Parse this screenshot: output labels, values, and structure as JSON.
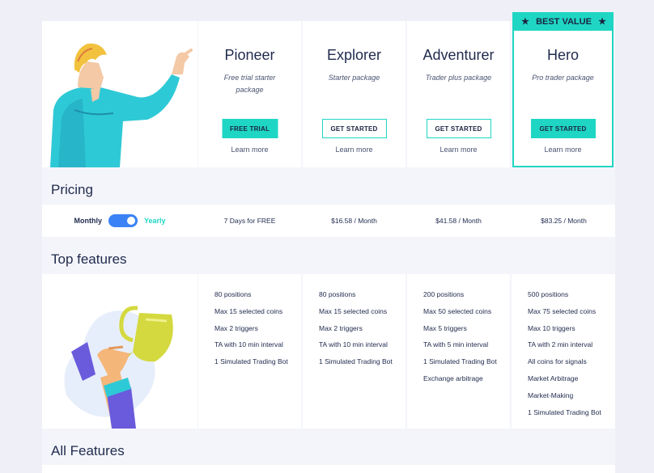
{
  "plans": [
    {
      "name": "Pioneer",
      "subtitle": "Free trial starter package",
      "button": "FREE TRIAL",
      "learn": "Learn more"
    },
    {
      "name": "Explorer",
      "subtitle": "Starter package",
      "button": "GET STARTED",
      "learn": "Learn more"
    },
    {
      "name": "Adventurer",
      "subtitle": "Trader plus package",
      "button": "GET STARTED",
      "learn": "Learn more"
    },
    {
      "name": "Hero",
      "subtitle": "Pro trader package",
      "button": "GET STARTED",
      "learn": "Learn more"
    }
  ],
  "badge": {
    "label": "BEST VALUE",
    "icon": "star-icon"
  },
  "sections": {
    "pricing": "Pricing",
    "top_features": "Top features",
    "all_features": "All Features"
  },
  "billing": {
    "monthly": "Monthly",
    "yearly": "Yearly",
    "selected": "Yearly"
  },
  "prices": [
    "7 Days for FREE",
    "$16.58 / Month",
    "$41.58 / Month",
    "$83.25 / Month"
  ],
  "features": [
    [
      "80 positions",
      "Max 15 selected coins",
      "Max 2 triggers",
      "TA with 10 min interval",
      "1 Simulated Trading Bot"
    ],
    [
      "80 positions",
      "Max 15 selected coins",
      "Max 2 triggers",
      "TA with 10 min interval",
      "1 Simulated Trading Bot"
    ],
    [
      "200 positions",
      "Max 50 selected coins",
      "Max 5 triggers",
      "TA with 5 min interval",
      "1 Simulated Trading Bot",
      "Exchange arbitrage"
    ],
    [
      "500 positions",
      "Max 75 selected coins",
      "Max 10 triggers",
      "TA with 2 min interval",
      "All coins for signals",
      "Market Arbitrage",
      "Market-Making",
      "1 Simulated Trading Bot"
    ]
  ],
  "colors": {
    "accent": "#1fd6c4",
    "toggle": "#3b82f6",
    "text": "#1f2a4d"
  },
  "illustrations": [
    "pointing-man-illustration",
    "trophy-hand-illustration"
  ]
}
